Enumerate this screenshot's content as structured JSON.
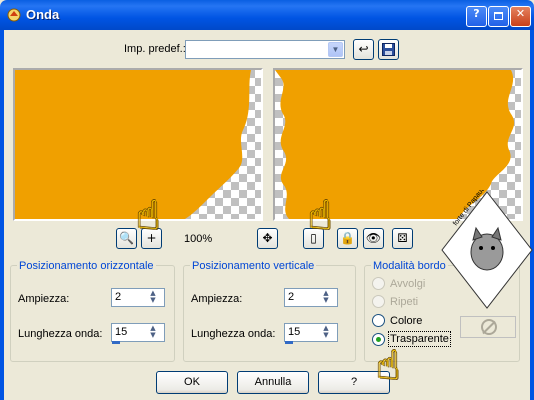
{
  "window": {
    "title": "Onda"
  },
  "preset": {
    "label": "Imp. predef.:",
    "value": ""
  },
  "zoom": {
    "level": "100%"
  },
  "horizontal": {
    "title": "Posizionamento orizzontale",
    "amplitude_label": "Ampiezza:",
    "amplitude": "2",
    "wavelength_label": "Lunghezza onda:",
    "wavelength": "15"
  },
  "vertical": {
    "title": "Posizionamento verticale",
    "amplitude_label": "Ampiezza:",
    "amplitude": "2",
    "wavelength_label": "Lunghezza onda:",
    "wavelength": "15"
  },
  "edge_mode": {
    "title": "Modalità bordo",
    "options": [
      {
        "label": "Avvolgi",
        "enabled": false,
        "selected": false
      },
      {
        "label": "Ripeti",
        "enabled": false,
        "selected": false
      },
      {
        "label": "Colore",
        "enabled": true,
        "selected": false
      },
      {
        "label": "Trasparente",
        "enabled": true,
        "selected": true
      }
    ]
  },
  "buttons": {
    "ok": "OK",
    "cancel": "Annulla",
    "help": "?"
  },
  "watermark": {
    "text": "forte di Papaudia"
  },
  "colors": {
    "preview_fill": "#F0A000",
    "title_bar": "#0054E3",
    "group_title": "#0046D5"
  }
}
